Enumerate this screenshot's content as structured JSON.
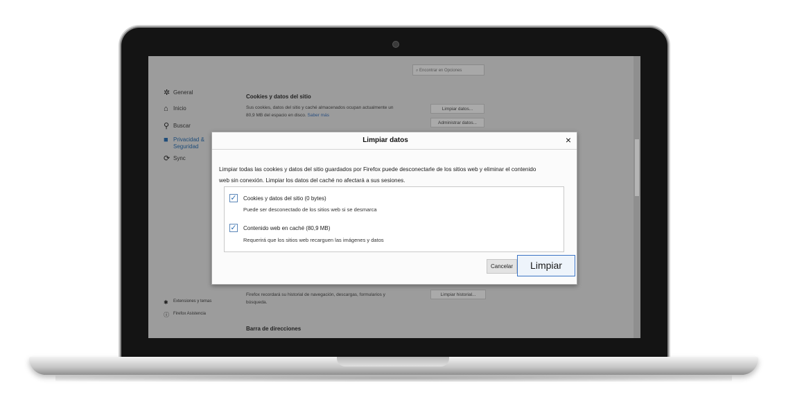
{
  "search": {
    "placeholder": "Encontrar en Opciones"
  },
  "sidebar": {
    "items": [
      {
        "label": "General",
        "icon": "gear-icon"
      },
      {
        "label": "Inicio",
        "icon": "home-icon"
      },
      {
        "label": "Buscar",
        "icon": "search-icon"
      },
      {
        "label": "Privacidad & Seguridad",
        "icon": "lock-icon"
      },
      {
        "label": "Sync",
        "icon": "sync-icon"
      }
    ],
    "footer": [
      {
        "label": "Extensiones y temas",
        "icon": "puzzle-icon"
      },
      {
        "label": "Firefox Asistencia",
        "icon": "help-icon"
      }
    ]
  },
  "cookies_section": {
    "title": "Cookies y datos del sitio",
    "desc_line1": "Sus cookies, datos del sitio y caché almacenados ocupan actualmente un",
    "desc_line2": "80,9 MB del espacio en disco.",
    "link": "Saber más",
    "clear_button": "Limpiar datos...",
    "manage_button": "Administrar datos..."
  },
  "history_section": {
    "desc_line1": "Firefox recordará su historial de navegación, descargas, formularios y",
    "desc_line2": "búsqueda.",
    "clear_button": "Limpiar historial..."
  },
  "address_bar_section": {
    "title": "Barra de direcciones"
  },
  "dialog": {
    "title": "Limpiar datos",
    "close": "×",
    "intro_line1": "Limpiar todas las cookies y datos del sitio guardados por Firefox puede desconectarle de los sitios web y eliminar el contenido",
    "intro_line2": "web sin conexión. Limpiar los datos del caché no afectará a sus sesiones.",
    "options": [
      {
        "label": "Cookies y datos del sitio (0 bytes)",
        "description": "Puede ser desconectado de los sitios web si se desmarca",
        "checked": true
      },
      {
        "label": "Contenido web en caché (80,9 MB)",
        "description": "Requerirá que los sitios web recarguen las imágenes y datos",
        "checked": true
      }
    ],
    "cancel_label": "Cancelar",
    "confirm_label": "Limpiar"
  },
  "colors": {
    "accent": "#3a73c4",
    "check": "#2e6fb4",
    "overlay": "#9c9c9c"
  }
}
